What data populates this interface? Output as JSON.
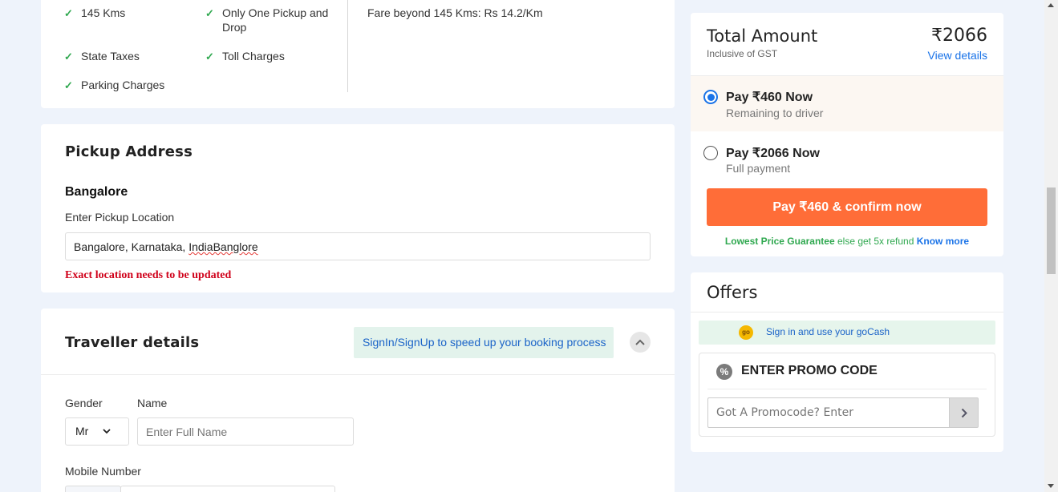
{
  "inclusions": {
    "items": [
      {
        "label": "145 Kms"
      },
      {
        "label": "Only One Pickup and Drop"
      },
      {
        "label": "State Taxes"
      },
      {
        "label": "Toll Charges"
      },
      {
        "label": "Parking Charges"
      }
    ],
    "fare_note": "Fare beyond 145 Kms: Rs 14.2/Km"
  },
  "pickup": {
    "title": "Pickup Address",
    "city": "Bangalore",
    "location_label": "Enter Pickup Location",
    "location_value_main": "Bangalore, Karnataka, ",
    "location_value_misspelled": "IndiaBanglore",
    "warning": "Exact location needs to be updated"
  },
  "traveller": {
    "title": "Traveller details",
    "signin_banner": "SignIn/SignUp to speed up your booking process",
    "gender_label": "Gender",
    "gender_value": "Mr",
    "name_label": "Name",
    "name_placeholder": "Enter Full Name",
    "mobile_label": "Mobile Number"
  },
  "payment": {
    "total_label": "Total Amount",
    "total_value": "₹2066",
    "gst_note": "Inclusive of GST",
    "view_details": "View details",
    "options": [
      {
        "title": "Pay ₹460 Now",
        "subtitle": "Remaining to driver",
        "selected": true
      },
      {
        "title": "Pay ₹2066 Now",
        "subtitle": "Full payment",
        "selected": false
      }
    ],
    "confirm_button": "Pay ₹460 & confirm now",
    "guarantee_green": "Lowest Price Guarantee",
    "guarantee_text": " else get 5x refund ",
    "guarantee_link": "Know more"
  },
  "offers": {
    "title": "Offers",
    "gocash_badge": "go",
    "gocash_text": "Sign in and use your goCash",
    "promo_title": "ENTER PROMO CODE",
    "promo_placeholder": "Got A Promocode? Enter"
  },
  "colors": {
    "accent_orange": "#ff6d38",
    "link_blue": "#1a73e8",
    "check_green": "#2fa84f",
    "warning_red": "#d0021b"
  },
  "icons": [
    "check-icon",
    "chevron-down-icon",
    "chevron-up-icon",
    "chevron-right-icon",
    "promo-percent-icon",
    "gocash-coin-icon"
  ]
}
